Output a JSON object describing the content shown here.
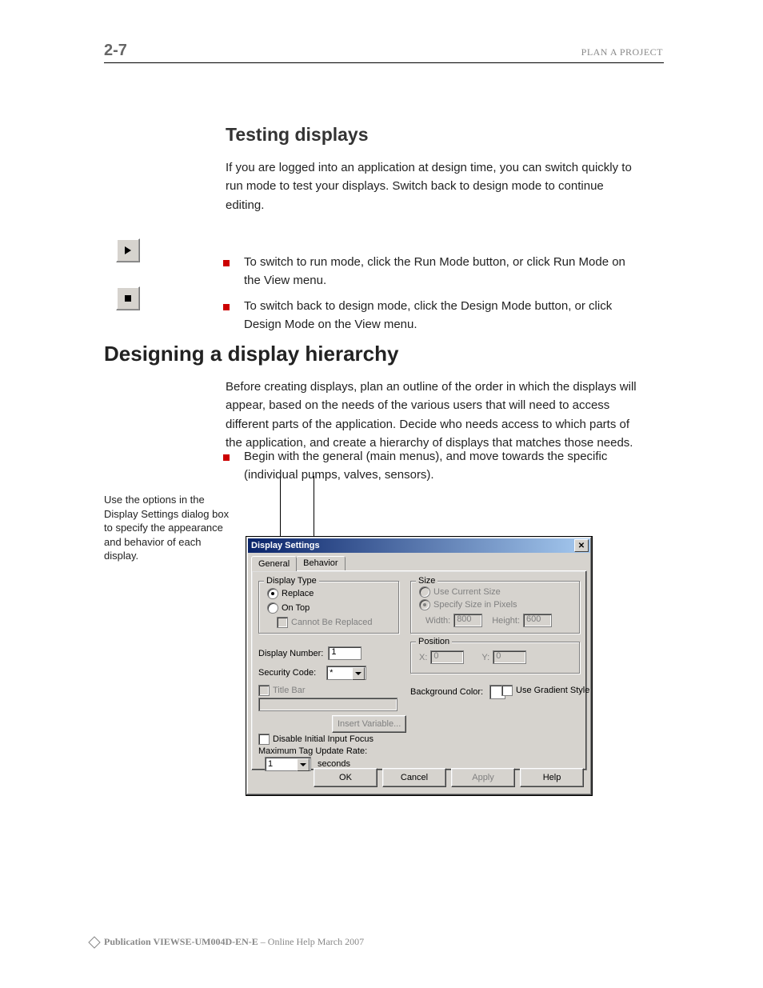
{
  "header": {
    "page_no": "2-7",
    "doc_title": "PLAN A PROJECT"
  },
  "section": {
    "title": "Testing displays",
    "para1_a": "If you are logged into an application at design time, you can switch quickly to run mode to test your displays. Switch back to design mode to continue editing.",
    "play_desc": "To switch to run mode, click the Run Mode button, or click Run Mode on the View menu.",
    "stop_desc": "To switch back to design mode, click the Design Mode button, or click Design Mode on the View menu."
  },
  "design": {
    "title": "Designing a display hierarchy",
    "para": "Before creating displays, plan an outline of the order in which the displays will appear, based on the needs of the various users that will need to access different parts of the application. Decide who needs access to which parts of the application, and create a hierarchy of displays that matches those needs.",
    "bullet": "Begin with the general (main menus), and move towards the specific (individual pumps, valves, sensors).",
    "caption": "Use the options in the Display Settings dialog box to specify the appearance and behavior of each display."
  },
  "dialog": {
    "title": "Display Settings",
    "tabs": {
      "general": "General",
      "behavior": "Behavior"
    },
    "display_type": {
      "legend": "Display Type",
      "replace": "Replace",
      "on_top": "On Top",
      "cannot_replace": "Cannot Be Replaced"
    },
    "size": {
      "legend": "Size",
      "use_current": "Use Current Size",
      "specify": "Specify Size in Pixels",
      "width_lbl": "Width:",
      "width_val": "800",
      "height_lbl": "Height:",
      "height_val": "600"
    },
    "position": {
      "legend": "Position",
      "x_lbl": "X:",
      "x_val": "0",
      "y_lbl": "Y:",
      "y_val": "0"
    },
    "display_number_lbl": "Display Number:",
    "display_number_val": "1",
    "security_lbl": "Security Code:",
    "security_val": "*",
    "title_bar_lbl": "Title Bar",
    "insert_var": "Insert Variable...",
    "disable_focus": "Disable Initial Input Focus",
    "max_rate_lbl": "Maximum Tag Update Rate:",
    "max_rate_val": "1",
    "max_rate_unit": "seconds",
    "bg_color_lbl": "Background Color:",
    "use_gradient": "Use Gradient Style",
    "buttons": {
      "ok": "OK",
      "cancel": "Cancel",
      "apply": "Apply",
      "help": "Help"
    }
  },
  "footer": {
    "pub": "Publication VIEWSE-UM004D-EN-E",
    "text": " – Online Help March 2007"
  }
}
